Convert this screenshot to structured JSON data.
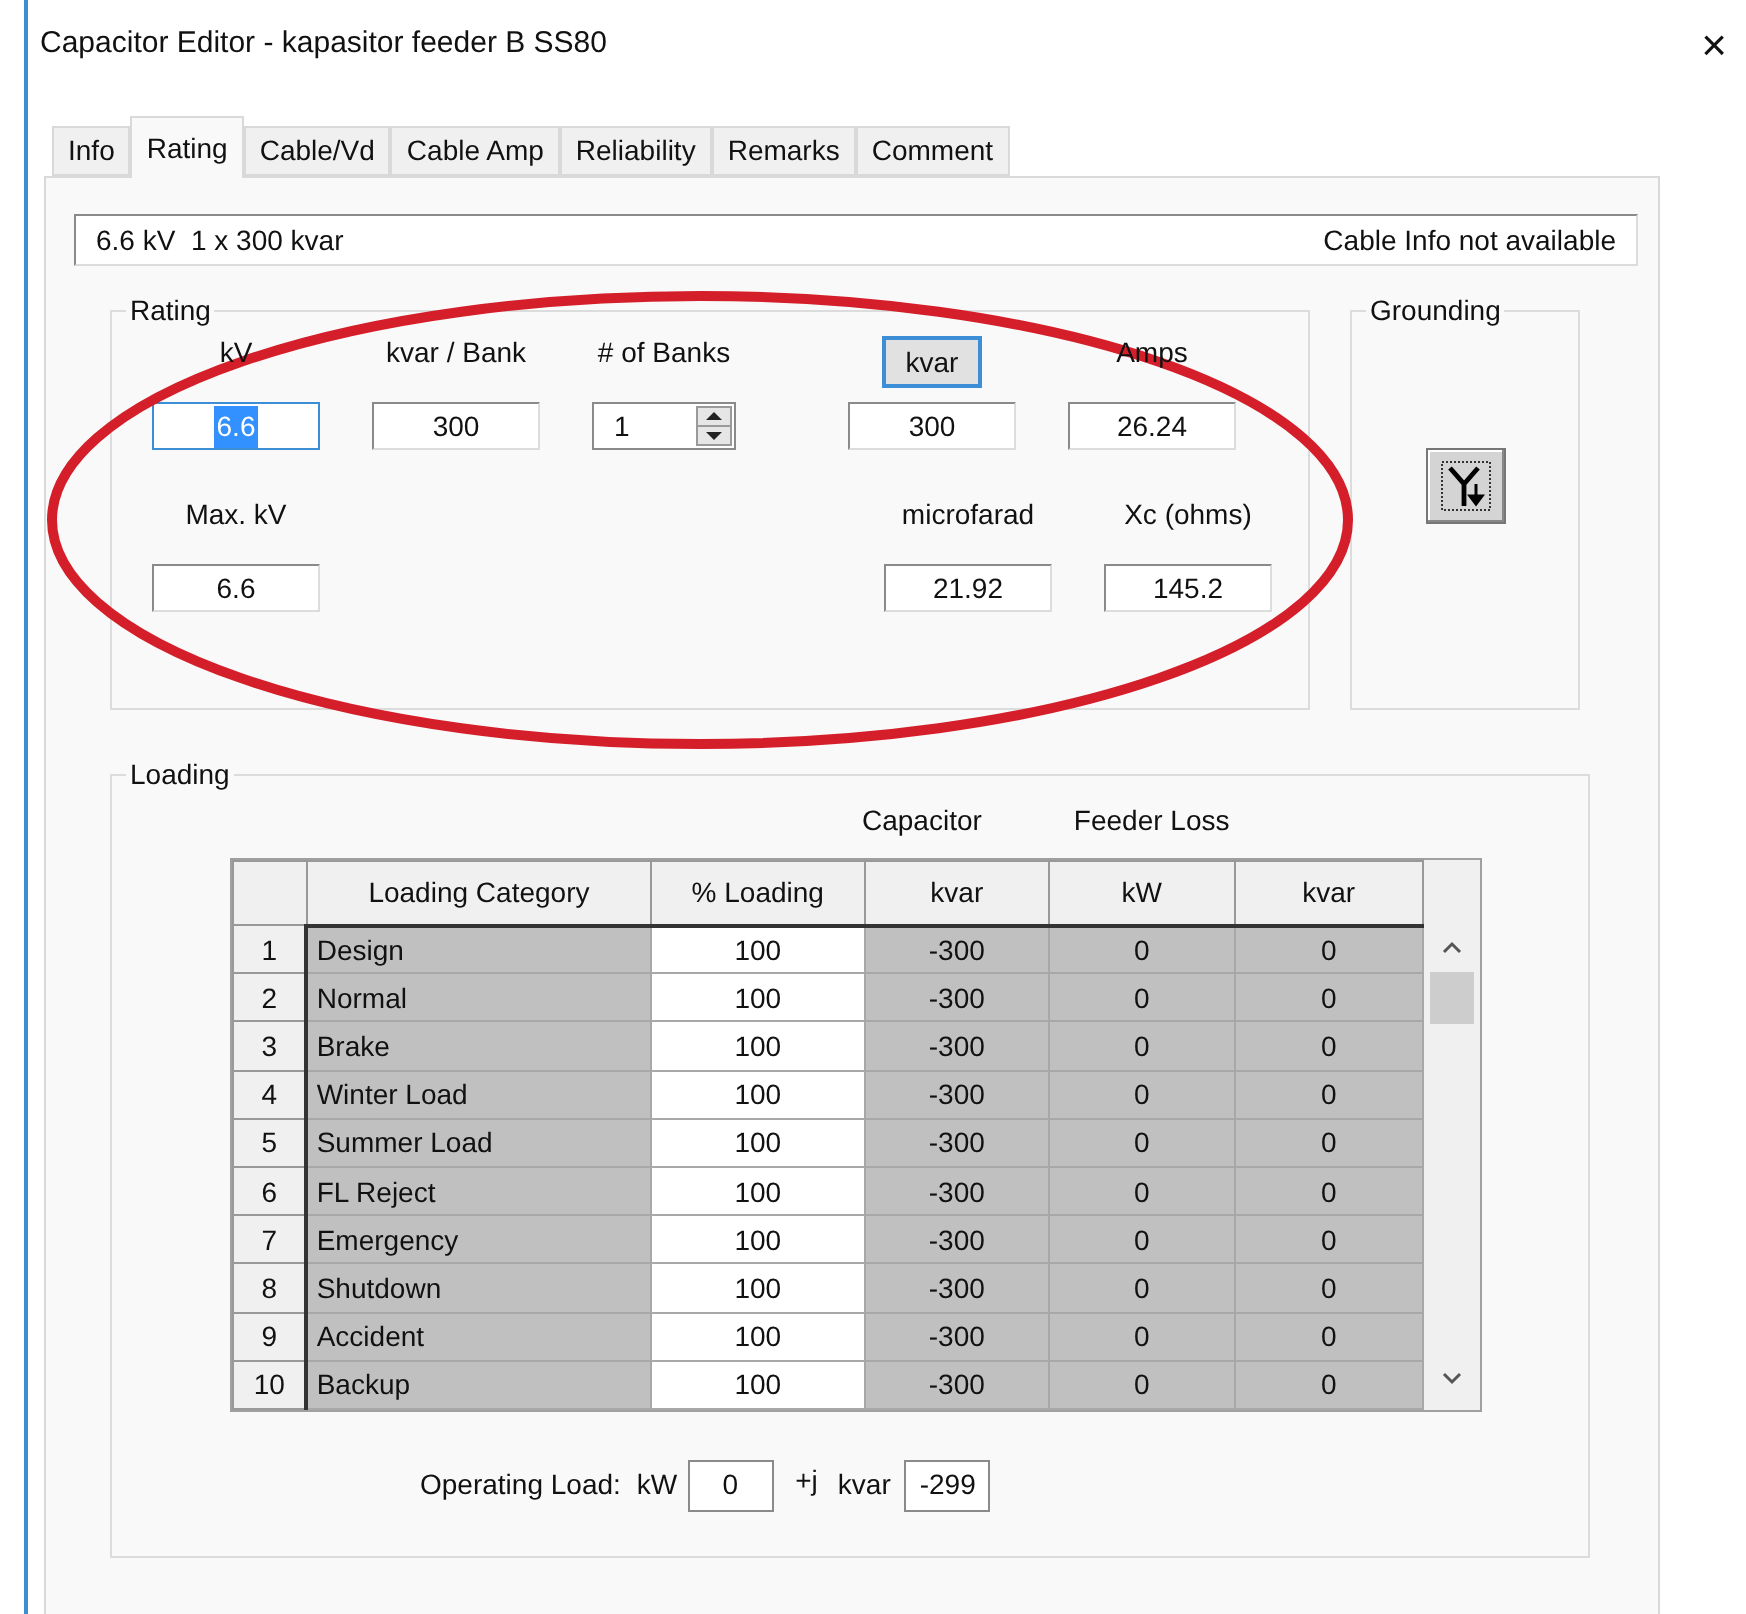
{
  "window": {
    "title": "Capacitor Editor - kapasitor feeder B SS80",
    "close": "×"
  },
  "tabs": [
    {
      "label": "Info",
      "selected": false
    },
    {
      "label": "Rating",
      "selected": true
    },
    {
      "label": "Cable/Vd",
      "selected": false
    },
    {
      "label": "Cable Amp",
      "selected": false
    },
    {
      "label": "Reliability",
      "selected": false
    },
    {
      "label": "Remarks",
      "selected": false
    },
    {
      "label": "Comment",
      "selected": false
    }
  ],
  "info_bar": {
    "summary": "6.6 kV  1 x 300 kvar",
    "cable_status": "Cable Info not available"
  },
  "rating": {
    "title": "Rating",
    "row_1": [
      {
        "label": "kV",
        "value": "6.6",
        "kind": "field",
        "focused": true
      },
      {
        "label": "kvar / Bank",
        "value": "300",
        "kind": "field",
        "focused": false
      },
      {
        "label": "# of Banks",
        "value": "1",
        "kind": "spinner",
        "focused": false
      },
      {
        "label": "kvar",
        "value": "300",
        "kind": "button",
        "focused": false
      },
      {
        "label": "Amps",
        "value": "26.24",
        "kind": "field",
        "focused": false
      }
    ],
    "row_2": [
      {
        "label": "Max. kV",
        "value": "6.6",
        "kind": "field",
        "focused": false
      },
      {
        "label": "microfarad",
        "value": "21.92",
        "kind": "field",
        "focused": false
      },
      {
        "label": "Xc (ohms)",
        "value": "145.2",
        "kind": "field",
        "focused": false
      }
    ]
  },
  "grounding": {
    "title": "Grounding"
  },
  "loading": {
    "title": "Loading",
    "group_headers": [
      "Capacitor",
      "Feeder Loss"
    ],
    "columns": [
      {
        "label": "Loading Category",
        "editable": false
      },
      {
        "label": "% Loading",
        "editable": true
      },
      {
        "label": "kvar",
        "editable": false
      },
      {
        "label": "kW",
        "editable": false
      },
      {
        "label": "kvar",
        "editable": false
      }
    ],
    "rows": [
      {
        "number": "1",
        "cells": [
          "Design",
          "100",
          "-300",
          "0",
          "0"
        ]
      },
      {
        "number": "2",
        "cells": [
          "Normal",
          "100",
          "-300",
          "0",
          "0"
        ]
      },
      {
        "number": "3",
        "cells": [
          "Brake",
          "100",
          "-300",
          "0",
          "0"
        ]
      },
      {
        "number": "4",
        "cells": [
          "Winter Load",
          "100",
          "-300",
          "0",
          "0"
        ]
      },
      {
        "number": "5",
        "cells": [
          "Summer Load",
          "100",
          "-300",
          "0",
          "0"
        ]
      },
      {
        "number": "6",
        "cells": [
          "FL Reject",
          "100",
          "-300",
          "0",
          "0"
        ]
      },
      {
        "number": "7",
        "cells": [
          "Emergency",
          "100",
          "-300",
          "0",
          "0"
        ]
      },
      {
        "number": "8",
        "cells": [
          "Shutdown",
          "100",
          "-300",
          "0",
          "0"
        ]
      },
      {
        "number": "9",
        "cells": [
          "Accident",
          "100",
          "-300",
          "0",
          "0"
        ]
      },
      {
        "number": "10",
        "cells": [
          "Backup",
          "100",
          "-300",
          "0",
          "0"
        ]
      }
    ],
    "operating_load": {
      "label": "Operating Load:",
      "kw_label": "kW",
      "kw_value": "0",
      "j_label": "+j",
      "kvar_label": "kvar",
      "kvar_value": "-299"
    }
  }
}
